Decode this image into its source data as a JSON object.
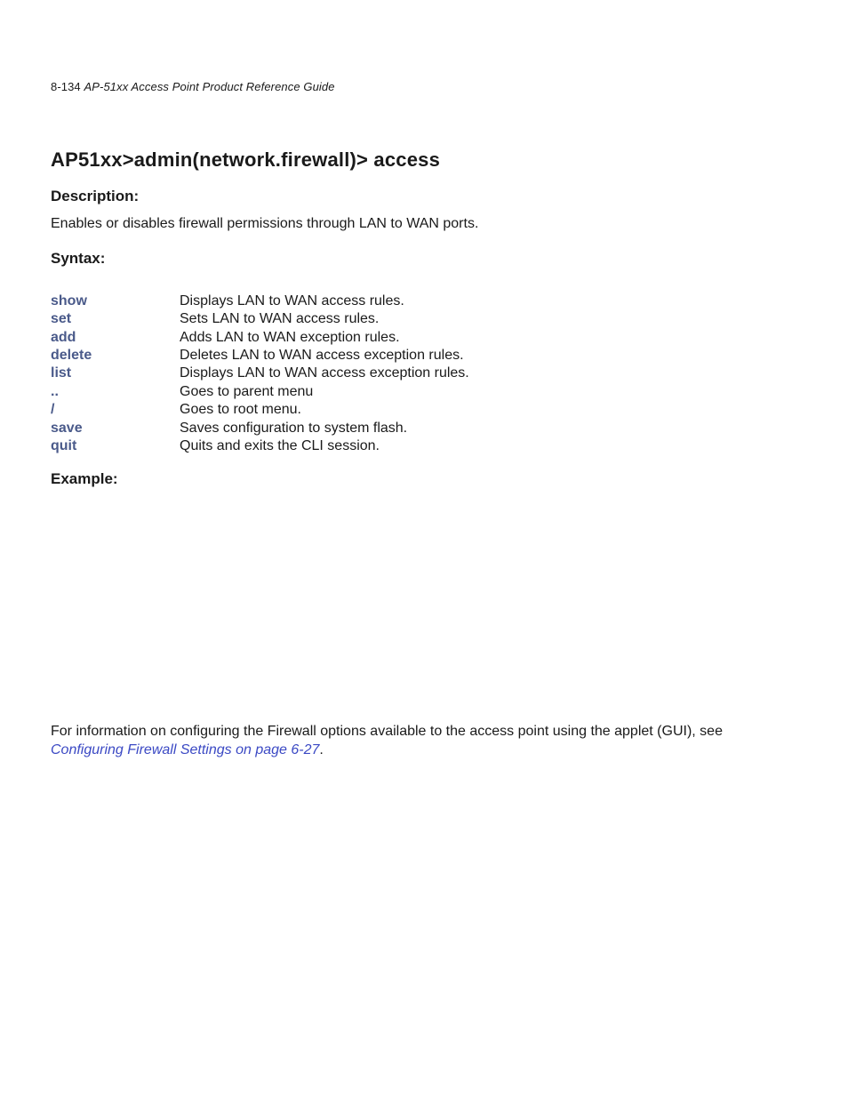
{
  "header": {
    "page_number": "8-134",
    "book_title": "AP-51xx Access Point Product Reference Guide"
  },
  "title": "AP51xx>admin(network.firewall)> access",
  "description_heading": "Description:",
  "description_body": "Enables or disables firewall permissions through LAN to WAN ports.",
  "syntax_heading": "Syntax:",
  "syntax": [
    {
      "cmd": "show",
      "desc": "Displays LAN to WAN access rules."
    },
    {
      "cmd": "set",
      "desc": "Sets LAN to WAN access rules."
    },
    {
      "cmd": "add",
      "desc": "Adds LAN to WAN exception rules."
    },
    {
      "cmd": "delete",
      "desc": "Deletes LAN to WAN access exception rules."
    },
    {
      "cmd": "list",
      "desc": "Displays LAN to WAN access exception rules."
    },
    {
      "cmd": "..",
      "desc": "Goes to parent menu"
    },
    {
      "cmd": "/",
      "desc": "Goes to root menu."
    },
    {
      "cmd": "save",
      "desc": "Saves configuration to system flash."
    },
    {
      "cmd": "quit",
      "desc": "Quits and exits the CLI session."
    }
  ],
  "example_heading": "Example:",
  "footer": {
    "lead": "For information on configuring the Firewall options available to the access point using the applet (GUI), see ",
    "xref": "Configuring Firewall Settings on page 6-27",
    "tail": "."
  }
}
